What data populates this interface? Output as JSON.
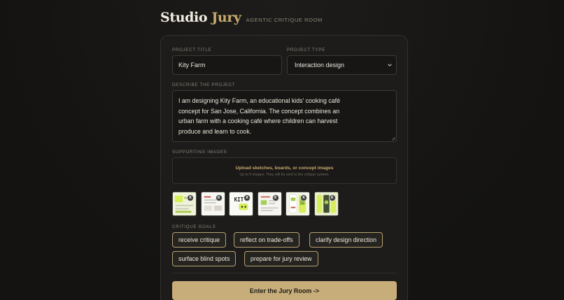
{
  "app": {
    "name_part1": "Studio",
    "name_part2": "Jury",
    "tagline": "AGENTIC CRITIQUE ROOM"
  },
  "form": {
    "project_title": {
      "label": "PROJECT TITLE",
      "value": "Kity Farm"
    },
    "project_type": {
      "label": "PROJECT TYPE",
      "value": "Interaction design"
    },
    "description": {
      "label": "DESCRIBE THE PROJECT",
      "lines": [
        "I am designing Kity Farm, an educational kids' cooking café",
        "concept for San Jose, California. The concept combines an",
        "urban farm with a cooking café where children can harvest",
        "produce and learn to cook."
      ]
    },
    "images": {
      "label": "SUPPORTING IMAGES",
      "upload_title": "Upload sketches, boards, or concept images",
      "upload_sub": "Up to 9 images. They will be sent to the critique system.",
      "remove_label": "x",
      "thumb_logo_text": "KIT"
    },
    "goals": {
      "label": "CRITIQUE GOALS",
      "items": [
        "receive critique",
        "reflect on trade-offs",
        "clarify design direction",
        "surface blind spots",
        "prepare for jury review"
      ]
    },
    "submit_label": "Enter the Jury Room ->"
  },
  "colors": {
    "background": "#151413",
    "card": "#1d1c1a",
    "accent": "#c8a96e",
    "button": "#c7ad79",
    "thumb_lime": "#d6ee5a"
  },
  "icons": {
    "select_arrow": "chevron-down-icon",
    "remove": "close-icon"
  }
}
